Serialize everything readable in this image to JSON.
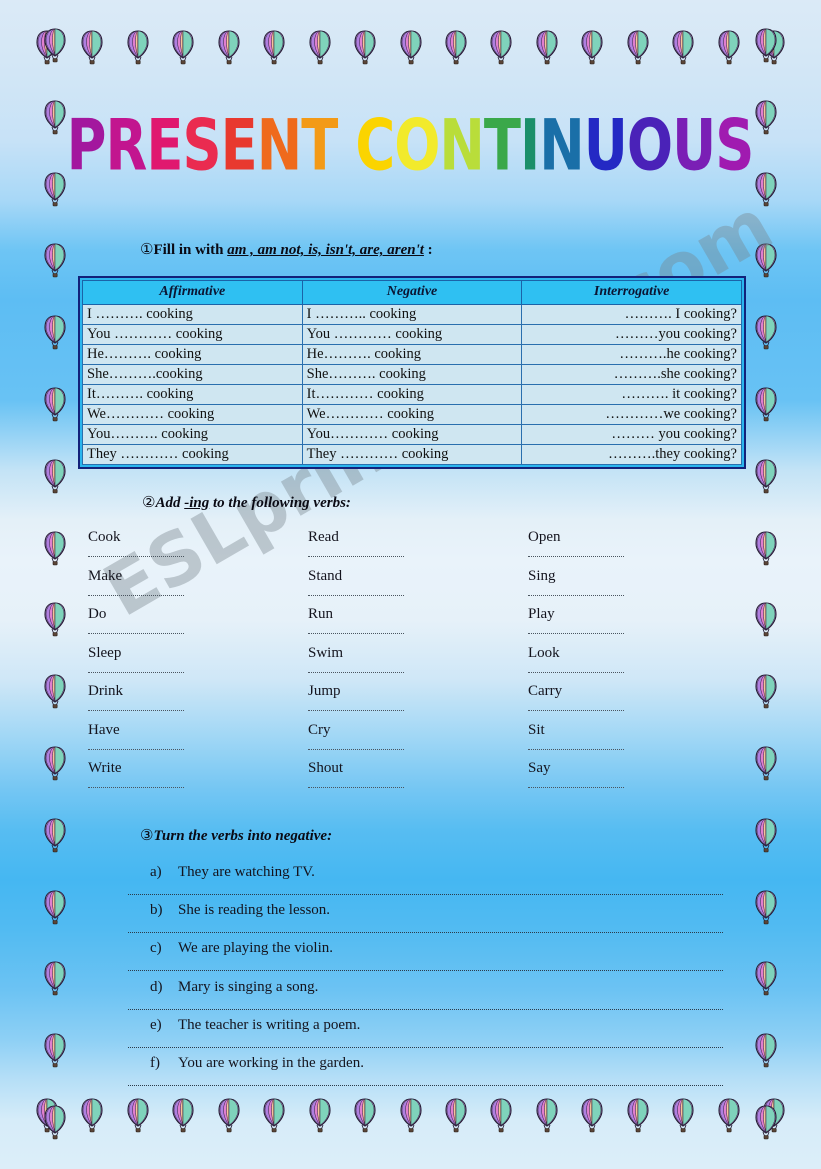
{
  "page": {
    "title_text": "PRESENT CONTINUOUS",
    "title_letters": [
      {
        "ch": "P",
        "color": "#a3179e"
      },
      {
        "ch": "R",
        "color": "#c2158f"
      },
      {
        "ch": "E",
        "color": "#e0186f"
      },
      {
        "ch": "S",
        "color": "#ea2b50"
      },
      {
        "ch": "E",
        "color": "#e8392f"
      },
      {
        "ch": "N",
        "color": "#ef6a1c"
      },
      {
        "ch": "T",
        "color": "#f39a17"
      },
      {
        "ch": " ",
        "color": "#ffffff"
      },
      {
        "ch": "C",
        "color": "#fbd400"
      },
      {
        "ch": "O",
        "color": "#f2ea2b"
      },
      {
        "ch": "N",
        "color": "#b9dd3a"
      },
      {
        "ch": "T",
        "color": "#3aa84a"
      },
      {
        "ch": "I",
        "color": "#1b8f6a"
      },
      {
        "ch": "N",
        "color": "#1a6fa8"
      },
      {
        "ch": "U",
        "color": "#2429c4"
      },
      {
        "ch": "O",
        "color": "#4a22b8"
      },
      {
        "ch": "U",
        "color": "#7a1fb5"
      },
      {
        "ch": "S",
        "color": "#a01bb0"
      }
    ],
    "watermark": "ESLprintables.com",
    "background_top": "#dbeaf7",
    "background_mid": "#45b7f2",
    "border_icon": "hot-air-balloon-icon",
    "border_balloon_count_top": 17,
    "border_balloon_count_side": 16
  },
  "exercise1": {
    "number": "①",
    "instruction_lead": "Fill in with ",
    "instruction_words": "am , am not, is, isn't, are, aren't",
    "instruction_tail": " :",
    "headers": [
      "Affirmative",
      "Negative",
      "Interrogative"
    ],
    "rows": [
      {
        "affirmative": "I ………. cooking",
        "negative": "I ……….. cooking",
        "interrogative": "………. I cooking?"
      },
      {
        "affirmative": "You ………… cooking",
        "negative": "You ………… cooking",
        "interrogative": "………you cooking?"
      },
      {
        "affirmative": "He………. cooking",
        "negative": "He………. cooking",
        "interrogative": "……….he cooking?"
      },
      {
        "affirmative": "She……….cooking",
        "negative": "She………. cooking",
        "interrogative": "……….she cooking?"
      },
      {
        "affirmative": "It………. cooking",
        "negative": "It………… cooking",
        "interrogative": "………. it cooking?"
      },
      {
        "affirmative": "We………… cooking",
        "negative": "We………… cooking",
        "interrogative": "…………we cooking?"
      },
      {
        "affirmative": "You………. cooking",
        "negative": "You………… cooking",
        "interrogative": "……… you cooking?"
      },
      {
        "affirmative": "They ………… cooking",
        "negative": "They ………… cooking",
        "interrogative": "……….they cooking?"
      }
    ]
  },
  "exercise2": {
    "number": "②",
    "instruction_lead": "Add ",
    "instruction_underlined": "-ing",
    "instruction_tail": " to the following verbs:",
    "columns": [
      [
        "Cook",
        "Make",
        "Do",
        "Sleep",
        "Drink",
        "Have",
        "Write"
      ],
      [
        "Read",
        "Stand",
        "Run",
        "Swim",
        "Jump",
        "Cry",
        "Shout"
      ],
      [
        "Open",
        "Sing",
        "Play",
        "Look",
        "Carry",
        "Sit",
        "Say"
      ]
    ]
  },
  "exercise3": {
    "number": "③",
    "instruction": "Turn the verbs into negative:",
    "items": [
      {
        "label": "a)",
        "text": "They are watching TV."
      },
      {
        "label": "b)",
        "text": "She is reading the lesson."
      },
      {
        "label": "c)",
        "text": "We are playing the violin."
      },
      {
        "label": "d)",
        "text": "Mary is singing a song."
      },
      {
        "label": "e)",
        "text": "The teacher is writing a poem."
      },
      {
        "label": "f)",
        "text": "You are working in the garden."
      }
    ]
  }
}
